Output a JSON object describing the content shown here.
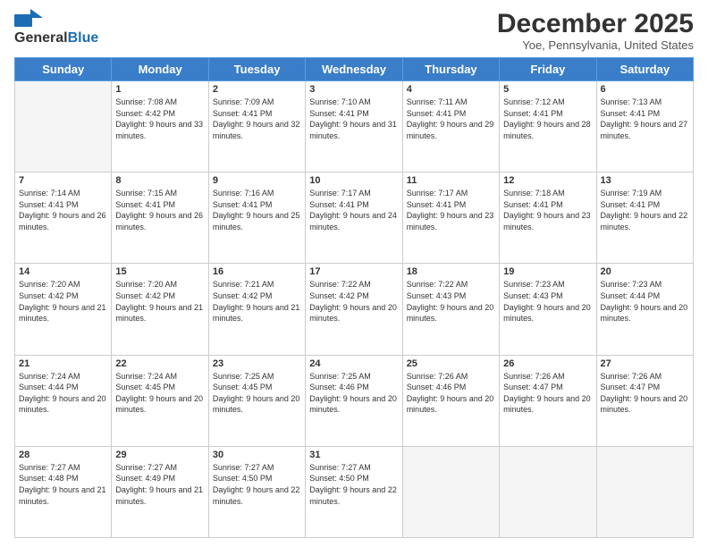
{
  "header": {
    "logo_general": "General",
    "logo_blue": "Blue",
    "month_title": "December 2025",
    "location": "Yoe, Pennsylvania, United States"
  },
  "days_of_week": [
    "Sunday",
    "Monday",
    "Tuesday",
    "Wednesday",
    "Thursday",
    "Friday",
    "Saturday"
  ],
  "weeks": [
    [
      {
        "day": "",
        "sunrise": "",
        "sunset": "",
        "daylight": ""
      },
      {
        "day": "1",
        "sunrise": "Sunrise: 7:08 AM",
        "sunset": "Sunset: 4:42 PM",
        "daylight": "Daylight: 9 hours and 33 minutes."
      },
      {
        "day": "2",
        "sunrise": "Sunrise: 7:09 AM",
        "sunset": "Sunset: 4:41 PM",
        "daylight": "Daylight: 9 hours and 32 minutes."
      },
      {
        "day": "3",
        "sunrise": "Sunrise: 7:10 AM",
        "sunset": "Sunset: 4:41 PM",
        "daylight": "Daylight: 9 hours and 31 minutes."
      },
      {
        "day": "4",
        "sunrise": "Sunrise: 7:11 AM",
        "sunset": "Sunset: 4:41 PM",
        "daylight": "Daylight: 9 hours and 29 minutes."
      },
      {
        "day": "5",
        "sunrise": "Sunrise: 7:12 AM",
        "sunset": "Sunset: 4:41 PM",
        "daylight": "Daylight: 9 hours and 28 minutes."
      },
      {
        "day": "6",
        "sunrise": "Sunrise: 7:13 AM",
        "sunset": "Sunset: 4:41 PM",
        "daylight": "Daylight: 9 hours and 27 minutes."
      }
    ],
    [
      {
        "day": "7",
        "sunrise": "Sunrise: 7:14 AM",
        "sunset": "Sunset: 4:41 PM",
        "daylight": "Daylight: 9 hours and 26 minutes."
      },
      {
        "day": "8",
        "sunrise": "Sunrise: 7:15 AM",
        "sunset": "Sunset: 4:41 PM",
        "daylight": "Daylight: 9 hours and 26 minutes."
      },
      {
        "day": "9",
        "sunrise": "Sunrise: 7:16 AM",
        "sunset": "Sunset: 4:41 PM",
        "daylight": "Daylight: 9 hours and 25 minutes."
      },
      {
        "day": "10",
        "sunrise": "Sunrise: 7:17 AM",
        "sunset": "Sunset: 4:41 PM",
        "daylight": "Daylight: 9 hours and 24 minutes."
      },
      {
        "day": "11",
        "sunrise": "Sunrise: 7:17 AM",
        "sunset": "Sunset: 4:41 PM",
        "daylight": "Daylight: 9 hours and 23 minutes."
      },
      {
        "day": "12",
        "sunrise": "Sunrise: 7:18 AM",
        "sunset": "Sunset: 4:41 PM",
        "daylight": "Daylight: 9 hours and 23 minutes."
      },
      {
        "day": "13",
        "sunrise": "Sunrise: 7:19 AM",
        "sunset": "Sunset: 4:41 PM",
        "daylight": "Daylight: 9 hours and 22 minutes."
      }
    ],
    [
      {
        "day": "14",
        "sunrise": "Sunrise: 7:20 AM",
        "sunset": "Sunset: 4:42 PM",
        "daylight": "Daylight: 9 hours and 21 minutes."
      },
      {
        "day": "15",
        "sunrise": "Sunrise: 7:20 AM",
        "sunset": "Sunset: 4:42 PM",
        "daylight": "Daylight: 9 hours and 21 minutes."
      },
      {
        "day": "16",
        "sunrise": "Sunrise: 7:21 AM",
        "sunset": "Sunset: 4:42 PM",
        "daylight": "Daylight: 9 hours and 21 minutes."
      },
      {
        "day": "17",
        "sunrise": "Sunrise: 7:22 AM",
        "sunset": "Sunset: 4:42 PM",
        "daylight": "Daylight: 9 hours and 20 minutes."
      },
      {
        "day": "18",
        "sunrise": "Sunrise: 7:22 AM",
        "sunset": "Sunset: 4:43 PM",
        "daylight": "Daylight: 9 hours and 20 minutes."
      },
      {
        "day": "19",
        "sunrise": "Sunrise: 7:23 AM",
        "sunset": "Sunset: 4:43 PM",
        "daylight": "Daylight: 9 hours and 20 minutes."
      },
      {
        "day": "20",
        "sunrise": "Sunrise: 7:23 AM",
        "sunset": "Sunset: 4:44 PM",
        "daylight": "Daylight: 9 hours and 20 minutes."
      }
    ],
    [
      {
        "day": "21",
        "sunrise": "Sunrise: 7:24 AM",
        "sunset": "Sunset: 4:44 PM",
        "daylight": "Daylight: 9 hours and 20 minutes."
      },
      {
        "day": "22",
        "sunrise": "Sunrise: 7:24 AM",
        "sunset": "Sunset: 4:45 PM",
        "daylight": "Daylight: 9 hours and 20 minutes."
      },
      {
        "day": "23",
        "sunrise": "Sunrise: 7:25 AM",
        "sunset": "Sunset: 4:45 PM",
        "daylight": "Daylight: 9 hours and 20 minutes."
      },
      {
        "day": "24",
        "sunrise": "Sunrise: 7:25 AM",
        "sunset": "Sunset: 4:46 PM",
        "daylight": "Daylight: 9 hours and 20 minutes."
      },
      {
        "day": "25",
        "sunrise": "Sunrise: 7:26 AM",
        "sunset": "Sunset: 4:46 PM",
        "daylight": "Daylight: 9 hours and 20 minutes."
      },
      {
        "day": "26",
        "sunrise": "Sunrise: 7:26 AM",
        "sunset": "Sunset: 4:47 PM",
        "daylight": "Daylight: 9 hours and 20 minutes."
      },
      {
        "day": "27",
        "sunrise": "Sunrise: 7:26 AM",
        "sunset": "Sunset: 4:47 PM",
        "daylight": "Daylight: 9 hours and 20 minutes."
      }
    ],
    [
      {
        "day": "28",
        "sunrise": "Sunrise: 7:27 AM",
        "sunset": "Sunset: 4:48 PM",
        "daylight": "Daylight: 9 hours and 21 minutes."
      },
      {
        "day": "29",
        "sunrise": "Sunrise: 7:27 AM",
        "sunset": "Sunset: 4:49 PM",
        "daylight": "Daylight: 9 hours and 21 minutes."
      },
      {
        "day": "30",
        "sunrise": "Sunrise: 7:27 AM",
        "sunset": "Sunset: 4:50 PM",
        "daylight": "Daylight: 9 hours and 22 minutes."
      },
      {
        "day": "31",
        "sunrise": "Sunrise: 7:27 AM",
        "sunset": "Sunset: 4:50 PM",
        "daylight": "Daylight: 9 hours and 22 minutes."
      },
      {
        "day": "",
        "sunrise": "",
        "sunset": "",
        "daylight": ""
      },
      {
        "day": "",
        "sunrise": "",
        "sunset": "",
        "daylight": ""
      },
      {
        "day": "",
        "sunrise": "",
        "sunset": "",
        "daylight": ""
      }
    ]
  ]
}
